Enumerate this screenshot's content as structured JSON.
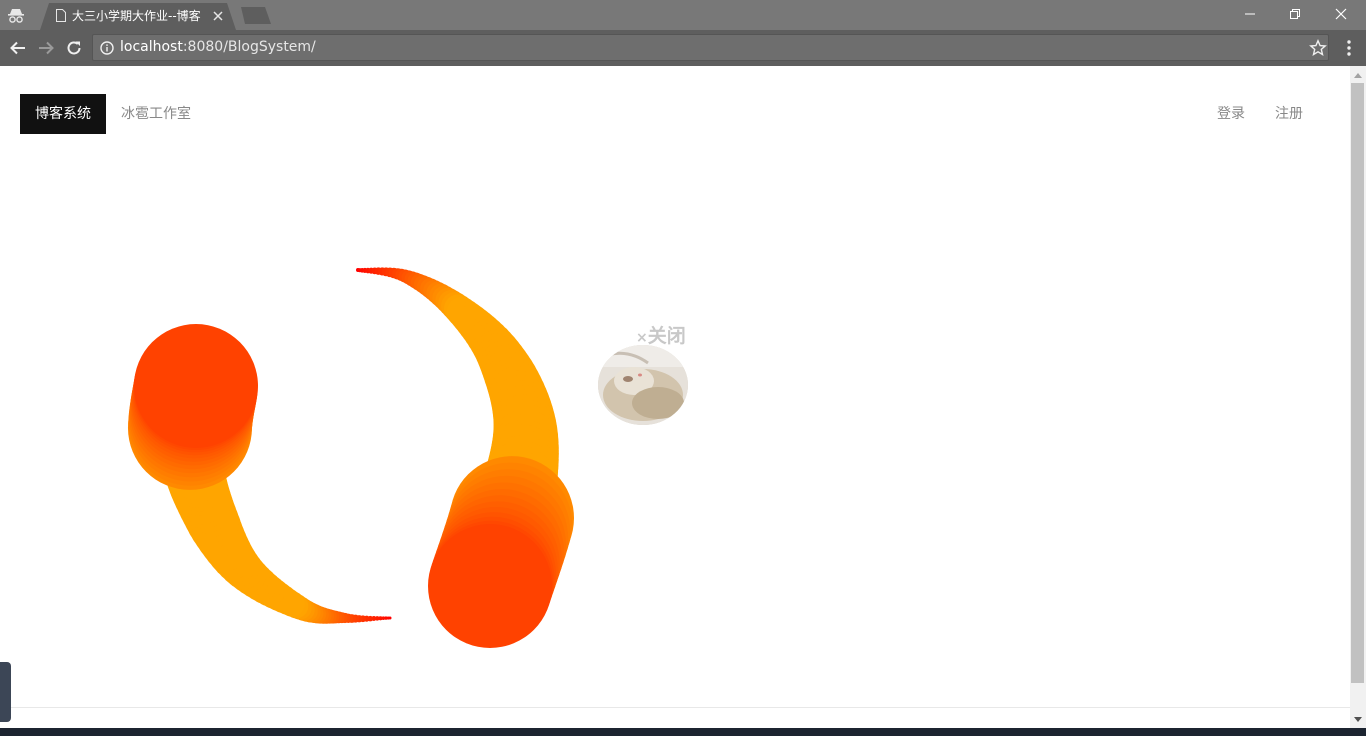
{
  "browser": {
    "tab_title": "大三小学期大作业--博客",
    "url_host": "localhost",
    "url_path": ":8080/BlogSystem/"
  },
  "nav": {
    "brand": "博客系统",
    "studio": "冰雹工作室",
    "login": "登录",
    "register": "注册"
  },
  "widget": {
    "close_x": "×",
    "close_label": "关闭"
  },
  "colors": {
    "accent_red": "#ff0000",
    "accent_orange": "#ffa500",
    "brand_bg": "#111111"
  },
  "icons": [
    "incognito-icon",
    "document-icon",
    "close-icon",
    "back-arrow-icon",
    "forward-arrow-icon",
    "reload-icon",
    "info-icon",
    "star-icon",
    "menu-dots-icon"
  ]
}
